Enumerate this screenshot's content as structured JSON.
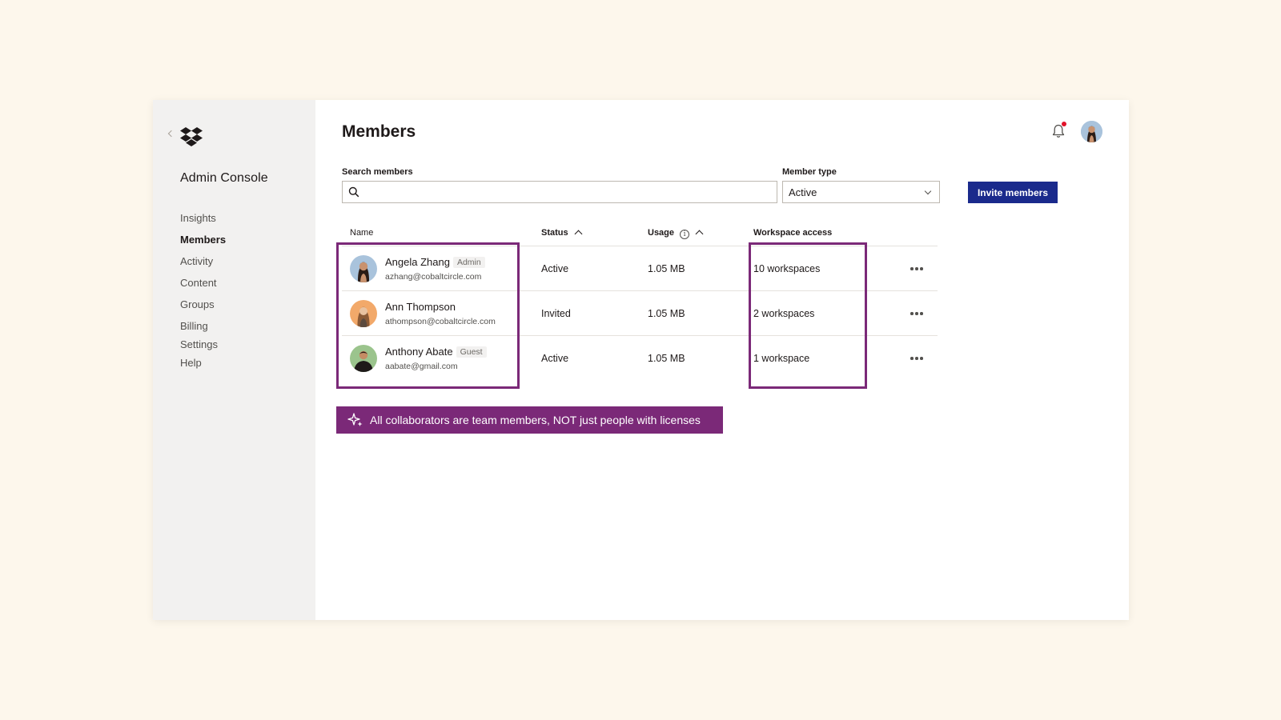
{
  "sidebar": {
    "title": "Admin Console",
    "items": [
      {
        "label": "Insights",
        "active": false
      },
      {
        "label": "Members",
        "active": true
      },
      {
        "label": "Activity",
        "active": false
      },
      {
        "label": "Content",
        "active": false
      },
      {
        "label": "Groups",
        "active": false
      },
      {
        "label": "Billing",
        "active": false
      },
      {
        "label": "Settings",
        "active": false
      },
      {
        "label": "Help",
        "active": false
      }
    ]
  },
  "header": {
    "title": "Members",
    "notification_indicator": true
  },
  "filters": {
    "search_label": "Search members",
    "search_value": "",
    "member_type_label": "Member type",
    "member_type_value": "Active",
    "invite_label": "Invite members"
  },
  "table": {
    "columns": {
      "name": "Name",
      "status": "Status",
      "usage": "Usage",
      "access": "Workspace access"
    },
    "rows": [
      {
        "name": "Angela Zhang",
        "badge": "Admin",
        "email": "azhang@cobaltcircle.com",
        "status": "Active",
        "usage": "1.05 MB",
        "access": "10 workspaces"
      },
      {
        "name": "Ann Thompson",
        "badge": "",
        "email": "athompson@cobaltcircle.com",
        "status": "Invited",
        "usage": "1.05 MB",
        "access": "2 workspaces"
      },
      {
        "name": "Anthony Abate",
        "badge": "Guest",
        "email": "aabate@gmail.com",
        "status": "Active",
        "usage": "1.05 MB",
        "access": "1 workspace"
      }
    ]
  },
  "callout": {
    "text": "All collaborators are team members, NOT just people with licenses",
    "icon": "sparkle-icon"
  },
  "colors": {
    "background": "#fdf7ec",
    "sidebar": "#f2f1f0",
    "primary_button": "#1a2a8c",
    "highlight": "#7b2978",
    "notification_dot": "#e2132a"
  }
}
